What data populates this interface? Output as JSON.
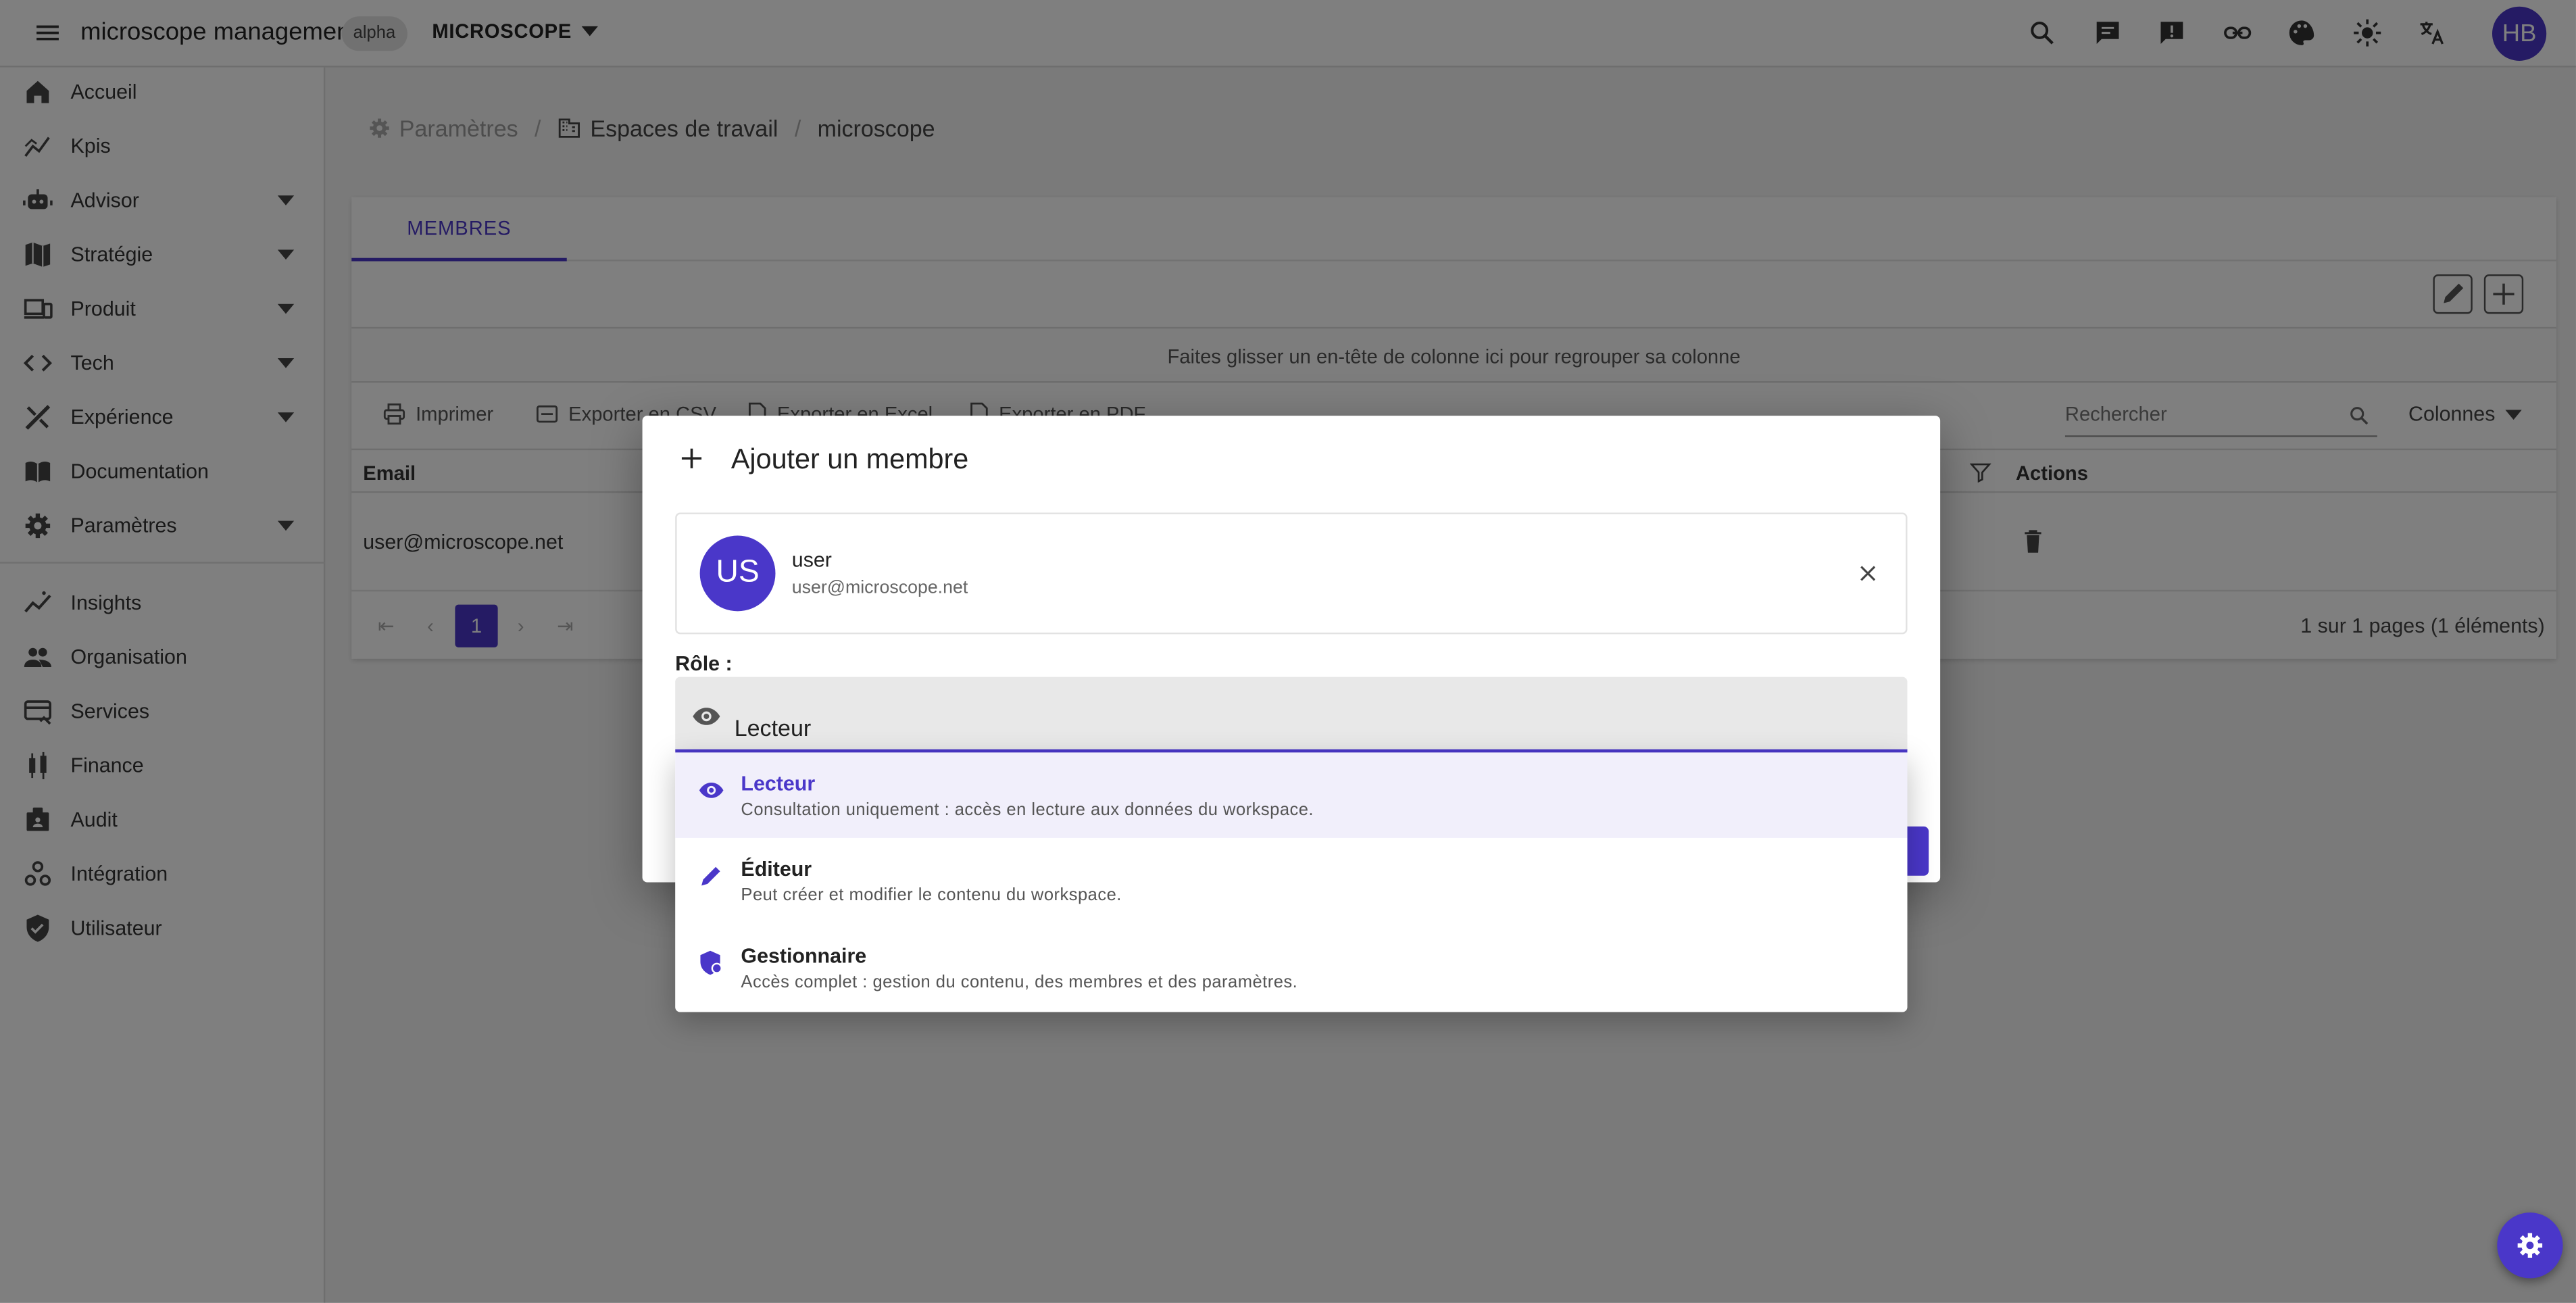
{
  "topbar": {
    "app_title": "microscope management",
    "env_badge": "alpha",
    "workspace": "MICROSCOPE",
    "user_initials": "HB"
  },
  "sidebar": {
    "items": [
      {
        "label": "Accueil",
        "icon": "home-icon",
        "expandable": false
      },
      {
        "label": "Kpis",
        "icon": "chart-icon",
        "expandable": false
      },
      {
        "label": "Advisor",
        "icon": "robot-icon",
        "expandable": true
      },
      {
        "label": "Stratégie",
        "icon": "map-icon",
        "expandable": true
      },
      {
        "label": "Produit",
        "icon": "devices-icon",
        "expandable": true
      },
      {
        "label": "Tech",
        "icon": "code-icon",
        "expandable": true
      },
      {
        "label": "Expérience",
        "icon": "design-icon",
        "expandable": true
      },
      {
        "label": "Documentation",
        "icon": "book-icon",
        "expandable": false
      },
      {
        "label": "Paramètres",
        "icon": "gear-icon",
        "expandable": true
      },
      {
        "label": "Insights",
        "icon": "insights-icon",
        "expandable": false
      },
      {
        "label": "Organisation",
        "icon": "people-icon",
        "expandable": false
      },
      {
        "label": "Services",
        "icon": "services-icon",
        "expandable": false
      },
      {
        "label": "Finance",
        "icon": "finance-icon",
        "expandable": false
      },
      {
        "label": "Audit",
        "icon": "audit-icon",
        "expandable": false
      },
      {
        "label": "Intégration",
        "icon": "integration-icon",
        "expandable": false
      },
      {
        "label": "Utilisateur",
        "icon": "shield-icon",
        "expandable": false
      }
    ]
  },
  "breadcrumb": {
    "settings": "Paramètres",
    "workspaces": "Espaces de travail",
    "current": "microscope"
  },
  "tabs": {
    "members": "MEMBRES"
  },
  "grid": {
    "group_hint": "Faites glisser un en-tête de colonne ici pour regrouper sa colonne",
    "print": "Imprimer",
    "export_csv": "Exporter en CSV",
    "export_excel": "Exporter en Excel",
    "export_pdf": "Exporter en PDF",
    "search_placeholder": "Rechercher",
    "columns": "Colonnes",
    "col_email": "Email",
    "col_actions": "Actions",
    "rows": [
      {
        "email": "user@microscope.net"
      }
    ],
    "page": "1",
    "pager_info": "1 sur 1 pages (1 éléments)"
  },
  "dialog": {
    "title": "Ajouter un membre",
    "user": {
      "initials": "US",
      "name": "user",
      "email": "user@microscope.net"
    },
    "role_label": "Rôle :",
    "role_value": "Lecteur",
    "options": [
      {
        "title": "Lecteur",
        "description": "Consultation uniquement : accès en lecture aux données du workspace.",
        "icon": "eye-icon",
        "selected": true
      },
      {
        "title": "Éditeur",
        "description": "Peut créer et modifier le contenu du workspace.",
        "icon": "pencil-icon",
        "selected": false
      },
      {
        "title": "Gestionnaire",
        "description": "Accès complet : gestion du contenu, des membres et des paramètres.",
        "icon": "admin-shield-icon",
        "selected": false
      }
    ]
  },
  "colors": {
    "accent": "#4a37c9"
  }
}
